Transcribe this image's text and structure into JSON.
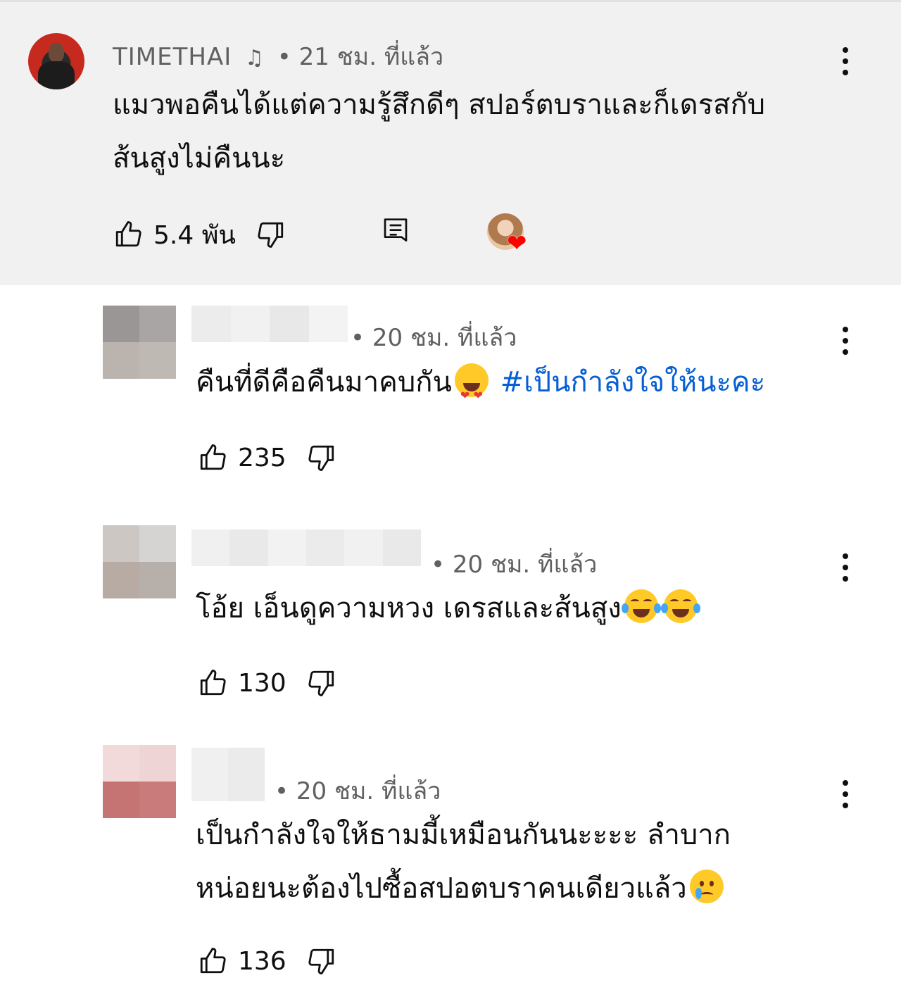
{
  "top_comment": {
    "author": "TIMETHAI",
    "author_badge_icon": "music-note-icon",
    "time": "21 ชม. ที่แล้ว",
    "separator": "•",
    "text_line1": "แมวพอคืนได้แต่ความรู้สึกดีๆ สปอร์ตบราและก็เดรสกับ",
    "text_line2": "ส้นสูงไม่คืนนะ",
    "likes": "5.4 พัน",
    "creator_heart": true
  },
  "replies": [
    {
      "author": "",
      "time": "20 ชม. ที่แล้ว",
      "text": "คืนที่ดีคือคืนมาคบกัน",
      "emoji": "smiling-face-with-heart-eyes",
      "hashtag": "#เป็นกำลังใจให้นะคะ",
      "likes": "235"
    },
    {
      "author": "",
      "time": "20 ชม. ที่แล้ว",
      "text": "โอ้ย เอ็นดูความหวง เดรสและส้นสูง",
      "emoji": "face-with-tears-of-joy",
      "likes": "130"
    },
    {
      "author": "",
      "time": "20 ชม. ที่แล้ว",
      "text_line1": "เป็นกำลังใจให้ธามมี้เหมือนกันนะะะะ ลำบาก",
      "text_line2": "หน่อยนะต้องไปซื้อสปอตบราคนเดียวแล้ว",
      "emoji": "crying-face",
      "likes": "136"
    }
  ],
  "colors": {
    "highlight_bg": "#f1f1f1",
    "meta_text": "#606060",
    "hashtag": "#065fd4",
    "heart": "#ff0000"
  }
}
